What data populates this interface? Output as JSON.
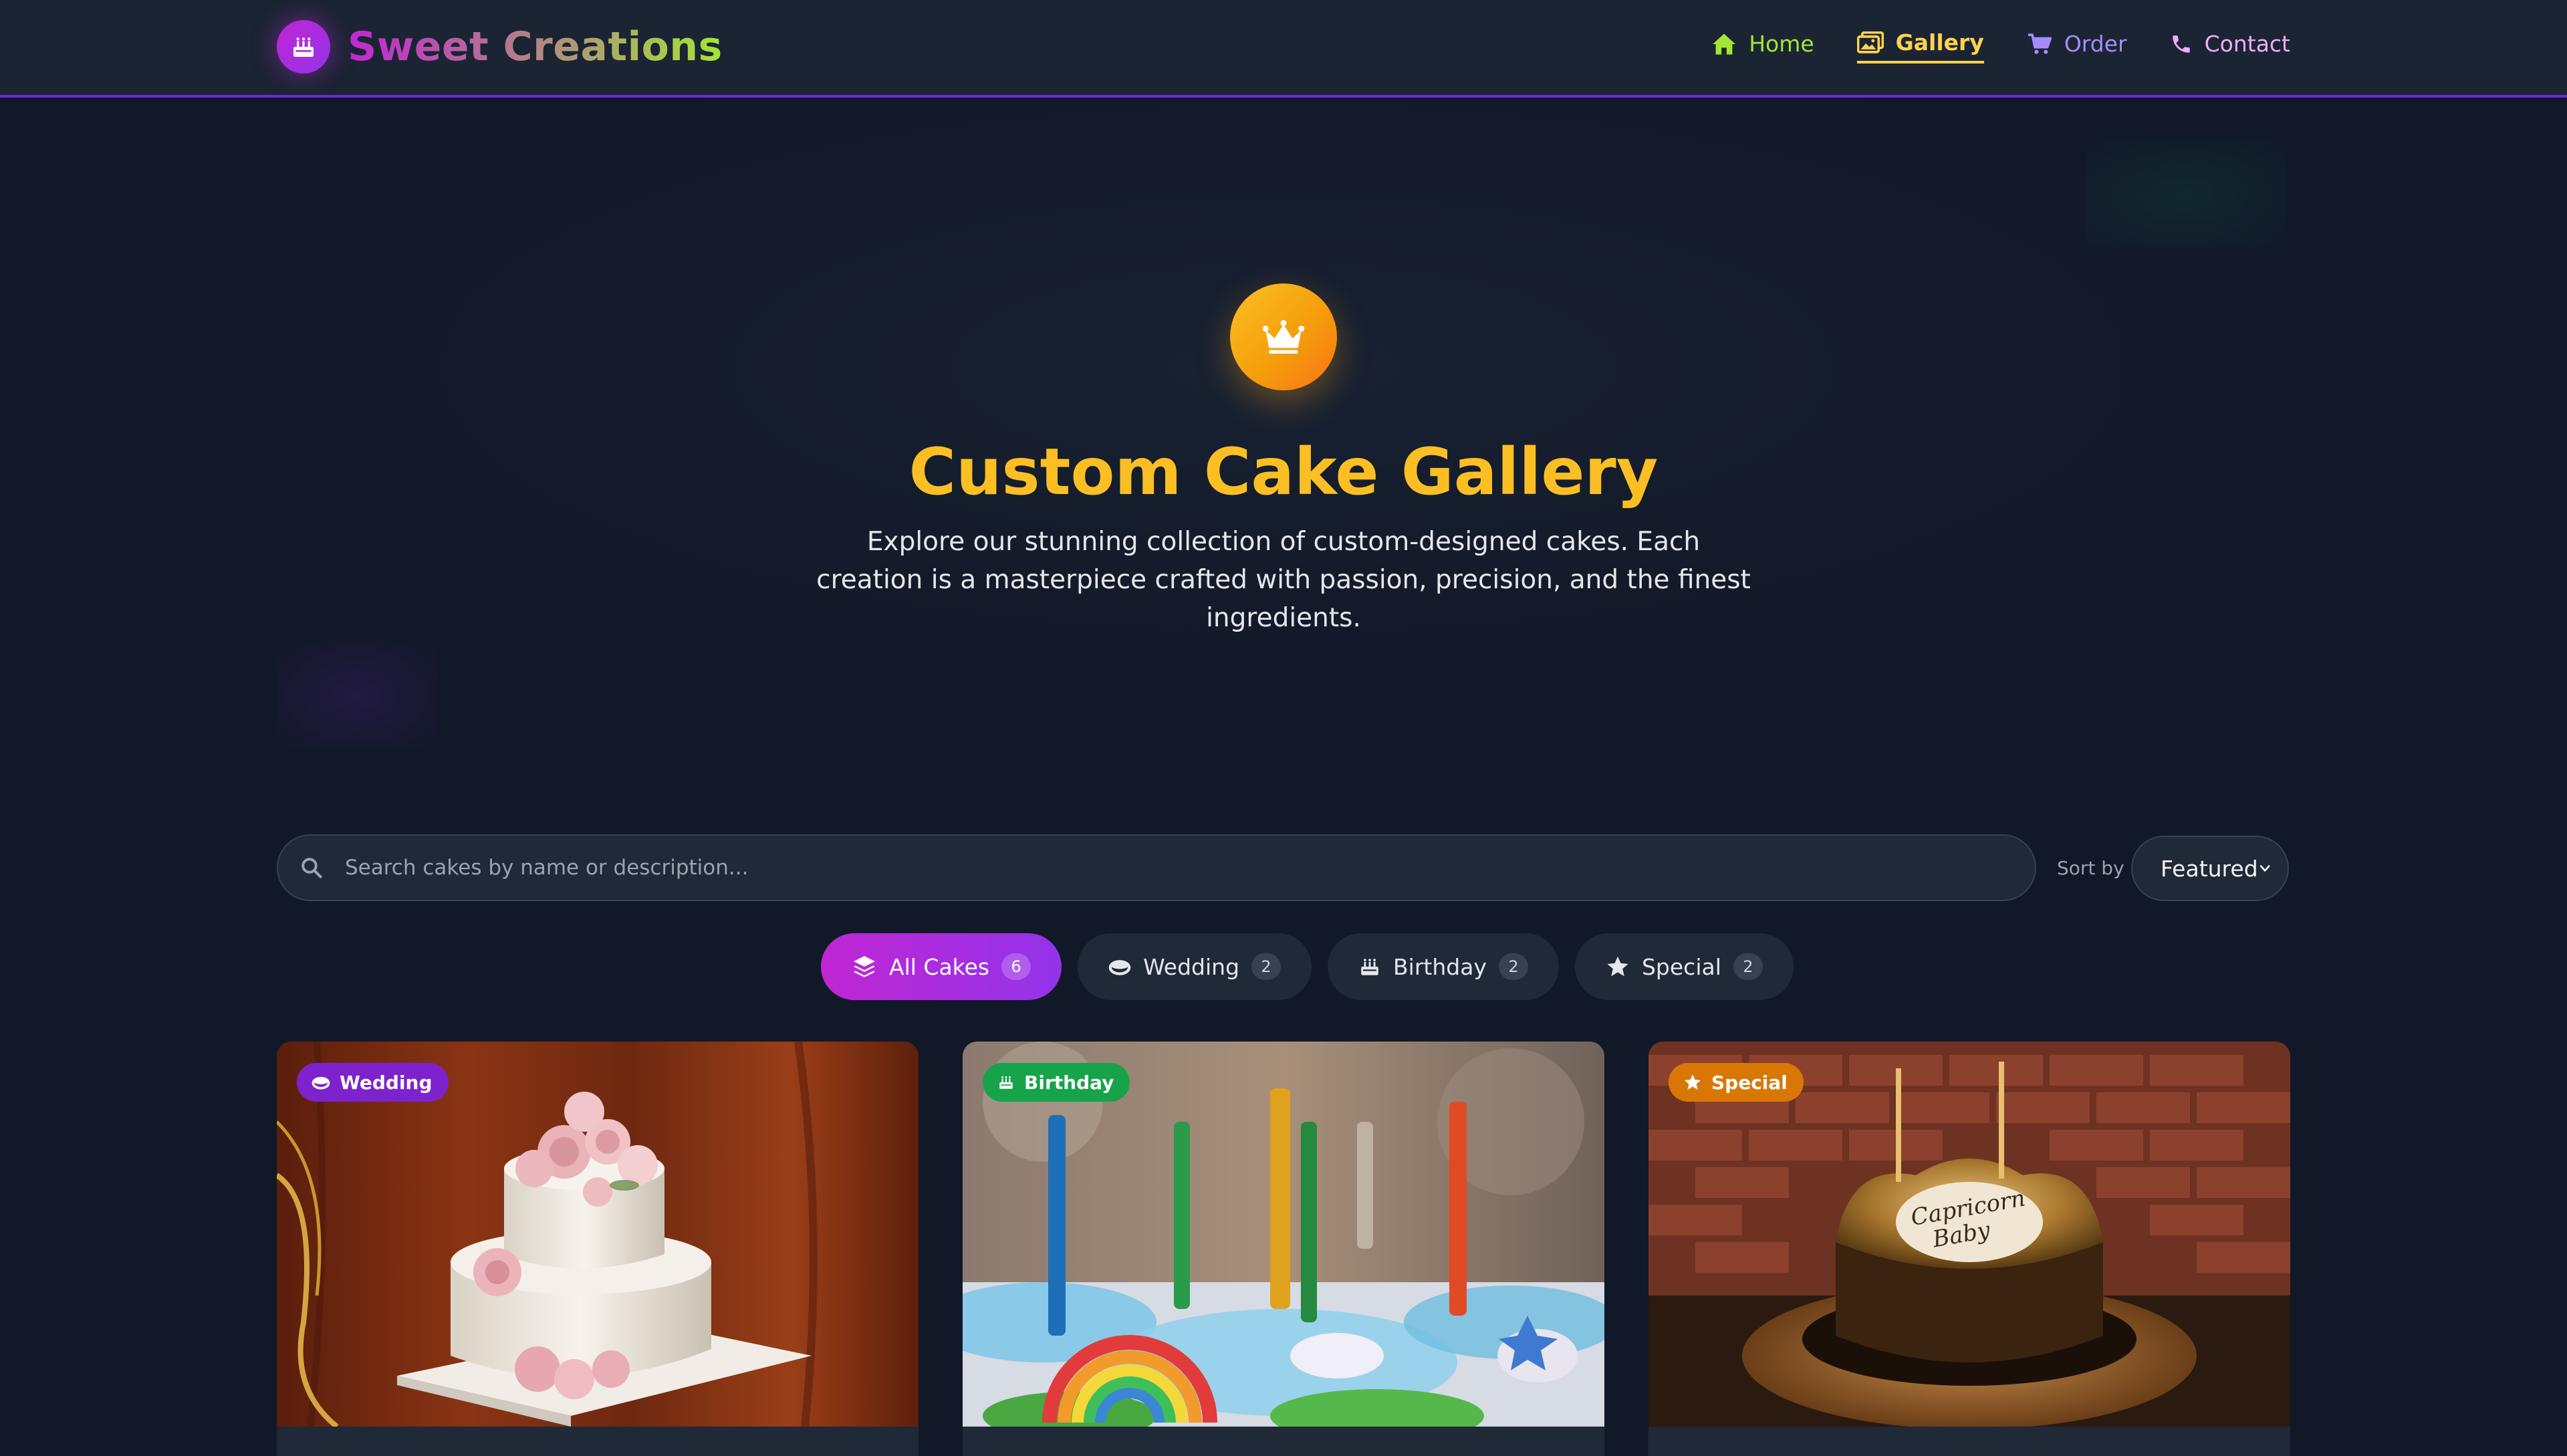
{
  "brand": {
    "name": "Sweet Creations",
    "icon": "cake-icon"
  },
  "nav": [
    {
      "label": "Home",
      "icon": "home-icon",
      "color": "#a3e635"
    },
    {
      "label": "Gallery",
      "icon": "images-icon",
      "color": "#fcd34d",
      "active": true
    },
    {
      "label": "Order",
      "icon": "cart-icon",
      "color": "#a78bfa"
    },
    {
      "label": "Contact",
      "icon": "phone-icon",
      "color": "#f0abfc"
    }
  ],
  "hero": {
    "icon": "crown-icon",
    "title": "Custom Cake Gallery",
    "subtitle": "Explore our stunning collection of custom-designed cakes. Each creation is a masterpiece crafted with passion, precision, and the finest ingredients."
  },
  "search": {
    "placeholder": "Search cakes by name or description...",
    "value": ""
  },
  "sort": {
    "label": "Sort by",
    "selected": "Featured"
  },
  "filters": [
    {
      "label": "All Cakes",
      "count": "6",
      "icon": "layers-icon",
      "active": true
    },
    {
      "label": "Wedding",
      "count": "2",
      "icon": "ring-icon"
    },
    {
      "label": "Birthday",
      "count": "2",
      "icon": "cake-icon"
    },
    {
      "label": "Special",
      "count": "2",
      "icon": "star-icon"
    }
  ],
  "cards": [
    {
      "category": "Wedding",
      "badge_icon": "ring-icon",
      "badge_color": "#7e22ce"
    },
    {
      "category": "Birthday",
      "badge_icon": "cake-icon",
      "badge_color": "#16a34a"
    },
    {
      "category": "Special",
      "badge_icon": "star-icon",
      "badge_color": "#d97706"
    }
  ],
  "colors": {
    "background": "#111827",
    "header": "#1b2433",
    "accent_purple": "#c026d3",
    "accent_gold": "#fbbf24"
  }
}
